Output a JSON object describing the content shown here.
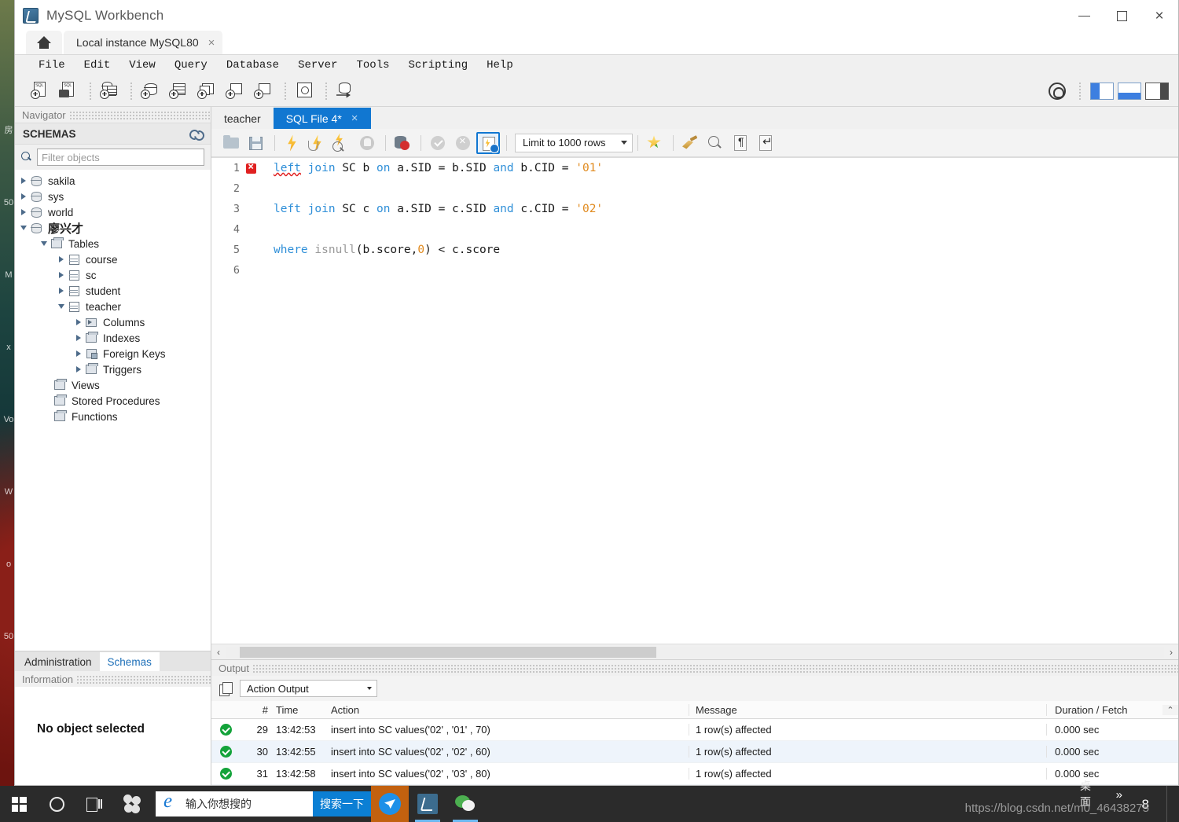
{
  "window": {
    "title": "MySQL Workbench",
    "minimize_label": "Minimize",
    "maximize_label": "Maximize",
    "close_label": "Close"
  },
  "tabs": {
    "home_label": "Home",
    "connection_label": "Local instance MySQL80",
    "close_glyph": "×"
  },
  "menu": {
    "items": [
      "File",
      "Edit",
      "View",
      "Query",
      "Database",
      "Server",
      "Tools",
      "Scripting",
      "Help"
    ]
  },
  "main_toolbar": {
    "icons": [
      "new-sql-tab-icon",
      "open-sql-script-icon",
      "connect-to-database-icon",
      "new-schema-icon",
      "new-table-icon",
      "new-view-icon",
      "new-stored-procedure-icon",
      "new-function-icon",
      "search-data-icon",
      "reconnect-to-server-icon"
    ],
    "scope_label": "scope-icon",
    "panel_toggles": [
      "toggle-sidebar",
      "toggle-output-panel",
      "toggle-secondary-sidebar"
    ]
  },
  "sidebar": {
    "navigator_caption": "Navigator",
    "schemas_header": "SCHEMAS",
    "refresh_label": "refresh-icon",
    "filter_placeholder": "Filter objects",
    "filter_value": "",
    "tree": [
      {
        "label": "sakila",
        "depth": 1,
        "icon": "schema-icon",
        "state": "collapsed"
      },
      {
        "label": "sys",
        "depth": 1,
        "icon": "schema-icon",
        "state": "collapsed"
      },
      {
        "label": "world",
        "depth": 1,
        "icon": "schema-icon",
        "state": "collapsed"
      },
      {
        "label": "廖兴才",
        "depth": 1,
        "icon": "schema-icon",
        "state": "expanded",
        "bold": true
      },
      {
        "label": "Tables",
        "depth": 2,
        "icon": "tables-folder-icon",
        "state": "expanded"
      },
      {
        "label": "course",
        "depth": 3,
        "icon": "table-icon",
        "state": "collapsed"
      },
      {
        "label": "sc",
        "depth": 3,
        "icon": "table-icon",
        "state": "collapsed"
      },
      {
        "label": "student",
        "depth": 3,
        "icon": "table-icon",
        "state": "collapsed"
      },
      {
        "label": "teacher",
        "depth": 3,
        "icon": "table-icon",
        "state": "expanded"
      },
      {
        "label": "Columns",
        "depth": 4,
        "icon": "columns-icon",
        "state": "collapsed"
      },
      {
        "label": "Indexes",
        "depth": 4,
        "icon": "indexes-icon",
        "state": "collapsed"
      },
      {
        "label": "Foreign Keys",
        "depth": 4,
        "icon": "foreign-keys-icon",
        "state": "collapsed"
      },
      {
        "label": "Triggers",
        "depth": 4,
        "icon": "triggers-icon",
        "state": "collapsed"
      },
      {
        "label": "Views",
        "depth": 2,
        "icon": "views-icon",
        "state": "leaf"
      },
      {
        "label": "Stored Procedures",
        "depth": 2,
        "icon": "stored-procedures-icon",
        "state": "leaf"
      },
      {
        "label": "Functions",
        "depth": 2,
        "icon": "functions-icon",
        "state": "leaf"
      }
    ],
    "bottom_tabs": [
      {
        "label": "Administration",
        "active": false
      },
      {
        "label": "Schemas",
        "active": true
      }
    ],
    "information_caption": "Information",
    "no_object_selected": "No object selected"
  },
  "editor": {
    "tabs": [
      {
        "label": "teacher",
        "active": false,
        "closable": false
      },
      {
        "label": "SQL File 4*",
        "active": true,
        "closable": true
      }
    ],
    "toolbar": {
      "icons": [
        "open-script-icon",
        "save-script-icon",
        "execute-statement-icon",
        "execute-current-statement-icon",
        "explain-statement-icon",
        "stop-execution-icon",
        "toggle-stop-on-error-icon",
        "commit-icon",
        "rollback-icon",
        "toggle-autocommit-icon"
      ],
      "limit_label": "Limit to 1000 rows",
      "right_icons": [
        "add-snippet-icon",
        "beautify-query-icon",
        "find-icon",
        "show-invisible-characters-icon",
        "toggle-word-wrap-icon"
      ]
    },
    "code_lines": [
      {
        "number": "1",
        "has_error": true,
        "tokens": [
          {
            "t": "left",
            "c": "kw-err"
          },
          {
            "t": " ",
            "c": "op"
          },
          {
            "t": "join",
            "c": "kw"
          },
          {
            "t": " ",
            "c": "op"
          },
          {
            "t": "SC",
            "c": "id"
          },
          {
            "t": " ",
            "c": "op"
          },
          {
            "t": "b",
            "c": "id"
          },
          {
            "t": " ",
            "c": "op"
          },
          {
            "t": "on",
            "c": "kw"
          },
          {
            "t": " ",
            "c": "op"
          },
          {
            "t": "a.SID",
            "c": "id"
          },
          {
            "t": " = ",
            "c": "op"
          },
          {
            "t": "b.SID",
            "c": "id"
          },
          {
            "t": " ",
            "c": "op"
          },
          {
            "t": "and",
            "c": "kw"
          },
          {
            "t": " ",
            "c": "op"
          },
          {
            "t": "b.CID",
            "c": "id"
          },
          {
            "t": " = ",
            "c": "op"
          },
          {
            "t": "'01'",
            "c": "str"
          }
        ]
      },
      {
        "number": "2",
        "has_error": false,
        "tokens": []
      },
      {
        "number": "3",
        "has_error": false,
        "tokens": [
          {
            "t": "left",
            "c": "kw"
          },
          {
            "t": " ",
            "c": "op"
          },
          {
            "t": "join",
            "c": "kw"
          },
          {
            "t": " ",
            "c": "op"
          },
          {
            "t": "SC",
            "c": "id"
          },
          {
            "t": " ",
            "c": "op"
          },
          {
            "t": "c",
            "c": "id"
          },
          {
            "t": " ",
            "c": "op"
          },
          {
            "t": "on",
            "c": "kw"
          },
          {
            "t": " ",
            "c": "op"
          },
          {
            "t": "a.SID",
            "c": "id"
          },
          {
            "t": " = ",
            "c": "op"
          },
          {
            "t": "c.SID",
            "c": "id"
          },
          {
            "t": " ",
            "c": "op"
          },
          {
            "t": "and",
            "c": "kw"
          },
          {
            "t": " ",
            "c": "op"
          },
          {
            "t": "c.CID",
            "c": "id"
          },
          {
            "t": " = ",
            "c": "op"
          },
          {
            "t": "'02'",
            "c": "str"
          }
        ]
      },
      {
        "number": "4",
        "has_error": false,
        "tokens": []
      },
      {
        "number": "5",
        "has_error": false,
        "tokens": [
          {
            "t": "where",
            "c": "kw"
          },
          {
            "t": " ",
            "c": "op"
          },
          {
            "t": "isnull",
            "c": "fn"
          },
          {
            "t": "(",
            "c": "op"
          },
          {
            "t": "b.score",
            "c": "id"
          },
          {
            "t": ",",
            "c": "op"
          },
          {
            "t": "0",
            "c": "num"
          },
          {
            "t": ")",
            "c": "op"
          },
          {
            "t": " < ",
            "c": "op"
          },
          {
            "t": "c.score",
            "c": "id"
          }
        ]
      },
      {
        "number": "6",
        "has_error": false,
        "tokens": []
      }
    ],
    "scroll_left_glyph": "‹",
    "scroll_right_glyph": "›"
  },
  "output": {
    "caption": "Output",
    "copy_icon": "copy-icon",
    "selected_view": "Action Output",
    "columns": [
      "#",
      "Time",
      "Action",
      "Message",
      "Duration / Fetch"
    ],
    "rows": [
      {
        "status": "success",
        "num": "29",
        "time": "13:42:53",
        "action": "insert into SC values('02' , '01' , 70)",
        "message": "1 row(s) affected",
        "duration": "0.000 sec"
      },
      {
        "status": "success",
        "num": "30",
        "time": "13:42:55",
        "action": "insert into SC values('02' , '02' , 60)",
        "message": "1 row(s) affected",
        "duration": "0.000 sec"
      },
      {
        "status": "success",
        "num": "31",
        "time": "13:42:58",
        "action": "insert into SC values('02' , '03' , 80)",
        "message": "1 row(s) affected",
        "duration": "0.000 sec"
      }
    ],
    "scroll_up_glyph": "⌃"
  },
  "taskbar": {
    "start_label": "start-button",
    "cortana_label": "cortana-search",
    "taskview_label": "task-view",
    "pinwheel_label": "pinwheel-app",
    "search_placeholder": "输入你想搜的",
    "search_button": "搜索一下",
    "apps": [
      "thunder-app",
      "mysql-workbench-app",
      "wechat-app"
    ],
    "desktop_label": "桌面",
    "chevrons": "»",
    "notification_count": "8"
  },
  "watermark": {
    "text": "https://blog.csdn.net/m0_46438275"
  },
  "desktop": {
    "ghost_text": "房\n50\nM\nx\nVo\nW\no\n50"
  },
  "colors": {
    "accent_blue": "#1177d1",
    "keyword_blue": "#2f8fd8",
    "string_orange": "#e08a1e",
    "error_red": "#e02020",
    "success_green": "#13a33a",
    "taskbar_dark": "#2b2b2b",
    "search_blue": "#0b7fd4"
  }
}
